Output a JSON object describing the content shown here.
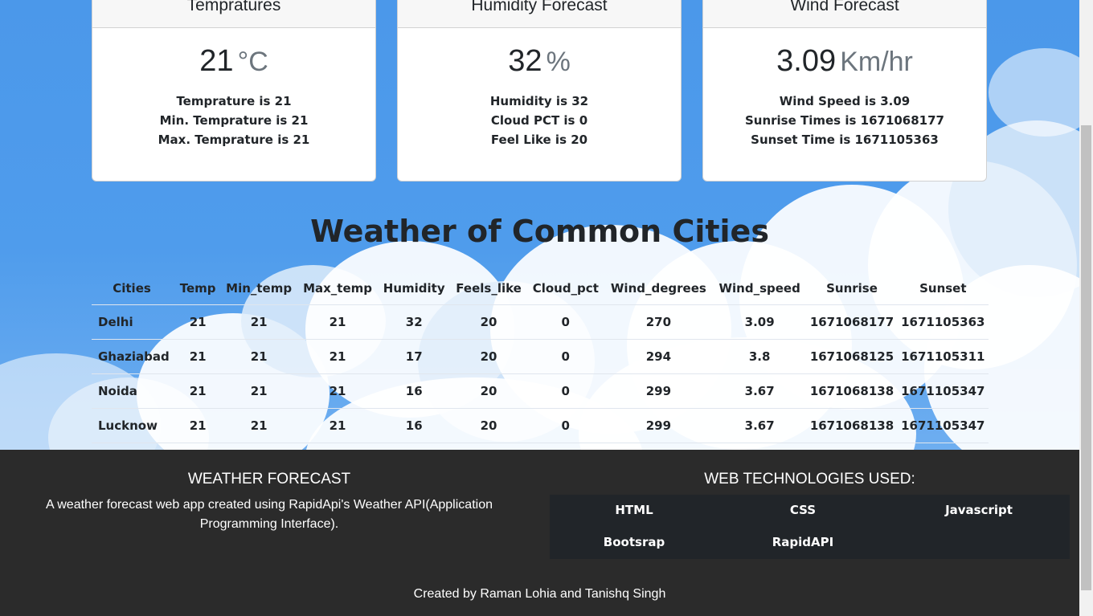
{
  "cards": [
    {
      "title": "Tempratures",
      "value": "21",
      "unit": "°C",
      "lines": [
        "Temprature is 21",
        "Min. Temprature is 21",
        "Max. Temprature is 21"
      ]
    },
    {
      "title": "Humidity Forecast",
      "value": "32",
      "unit": "%",
      "lines": [
        "Humidity is 32",
        "Cloud PCT is 0",
        "Feel Like is 20"
      ]
    },
    {
      "title": "Wind Forecast",
      "value": "3.09",
      "unit": "Km/hr",
      "lines": [
        "Wind Speed is 3.09",
        "Sunrise Times is 1671068177",
        "Sunset Time is 1671105363"
      ]
    }
  ],
  "section_title": "Weather of Common Cities",
  "table": {
    "headers": [
      "Cities",
      "Temp",
      "Min_temp",
      "Max_temp",
      "Humidity",
      "Feels_like",
      "Cloud_pct",
      "Wind_degrees",
      "Wind_speed",
      "Sunrise",
      "Sunset"
    ],
    "rows": [
      [
        "Delhi",
        "21",
        "21",
        "21",
        "32",
        "20",
        "0",
        "270",
        "3.09",
        "1671068177",
        "1671105363"
      ],
      [
        "Ghaziabad",
        "21",
        "21",
        "21",
        "17",
        "20",
        "0",
        "294",
        "3.8",
        "1671068125",
        "1671105311"
      ],
      [
        "Noida",
        "21",
        "21",
        "21",
        "16",
        "20",
        "0",
        "299",
        "3.67",
        "1671068138",
        "1671105347"
      ],
      [
        "Lucknow",
        "21",
        "21",
        "21",
        "16",
        "20",
        "0",
        "299",
        "3.67",
        "1671068138",
        "1671105347"
      ]
    ]
  },
  "footer": {
    "title": "WEATHER FORECAST",
    "description": "A weather forecast web app created using RapidApi's Weather API(Application Programming Interface).",
    "tech_title": "WEB TECHNOLOGIES USED:",
    "tech": [
      "HTML",
      "CSS",
      "Javascript",
      "Bootsrap",
      "RapidAPI"
    ],
    "credit": "Created by Raman Lohia and Tanishq Singh"
  },
  "colors": {
    "sky": "#4a95e6",
    "footer_bg": "#2b2b2b",
    "tech_bg": "#212529"
  }
}
